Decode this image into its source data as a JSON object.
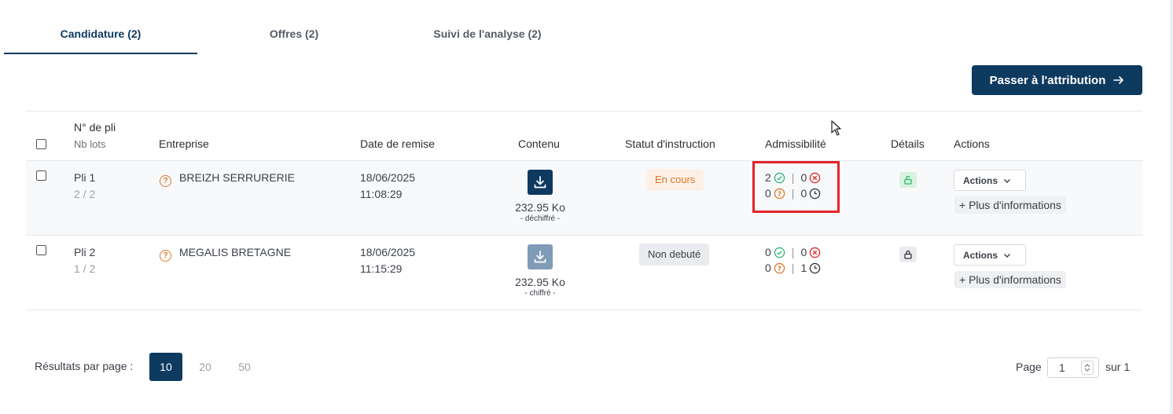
{
  "tabs": [
    {
      "label": "Candidature (2)",
      "active": true
    },
    {
      "label": "Offres (2)",
      "active": false
    },
    {
      "label": "Suivi de l'analyse (2)",
      "active": false
    }
  ],
  "attribution_button": {
    "label": "Passer à l'attribution",
    "icon": "arrow-right-icon"
  },
  "table": {
    "headers": {
      "pli": "N° de pli",
      "pli_sub": "Nb lots",
      "entreprise": "Entreprise",
      "date": "Date de remise",
      "contenu": "Contenu",
      "statut": "Statut d'instruction",
      "admissibilite": "Admissibilité",
      "details": "Détails",
      "actions": "Actions"
    },
    "rows": [
      {
        "pli": "Pli 1",
        "lots": "2 / 2",
        "entreprise": "BREIZH SERRURERIE",
        "date": "18/06/2025",
        "time": "11:08:29",
        "size": "232.95 Ko",
        "encryption": "- déchiffré -",
        "statut": "En cours",
        "adm_ok": "2",
        "adm_ko": "0",
        "adm_unknown": "0",
        "adm_pending": "0",
        "lock": "unlocked",
        "actions_label": "Actions",
        "more_label": "+ Plus d'informations"
      },
      {
        "pli": "Pli 2",
        "lots": "1 / 2",
        "entreprise": "MEGALIS BRETAGNE",
        "date": "18/06/2025",
        "time": "11:15:29",
        "size": "232.95 Ko",
        "encryption": "- chiffré -",
        "statut": "Non debuté",
        "adm_ok": "0",
        "adm_ko": "0",
        "adm_unknown": "0",
        "adm_pending": "1",
        "lock": "locked",
        "actions_label": "Actions",
        "more_label": "+ Plus d'informations"
      }
    ]
  },
  "pagination": {
    "per_page_label": "Résultats par page :",
    "per_page_options": [
      "10",
      "20",
      "50"
    ],
    "per_page_selected": "10",
    "page_label": "Page",
    "page_value": "1",
    "total_label": "sur 1"
  },
  "colors": {
    "primary": "#0f3a60",
    "ok": "#2bb673",
    "ko": "#e3242b",
    "warning": "#e0762a",
    "highlight": "#e3242b"
  }
}
